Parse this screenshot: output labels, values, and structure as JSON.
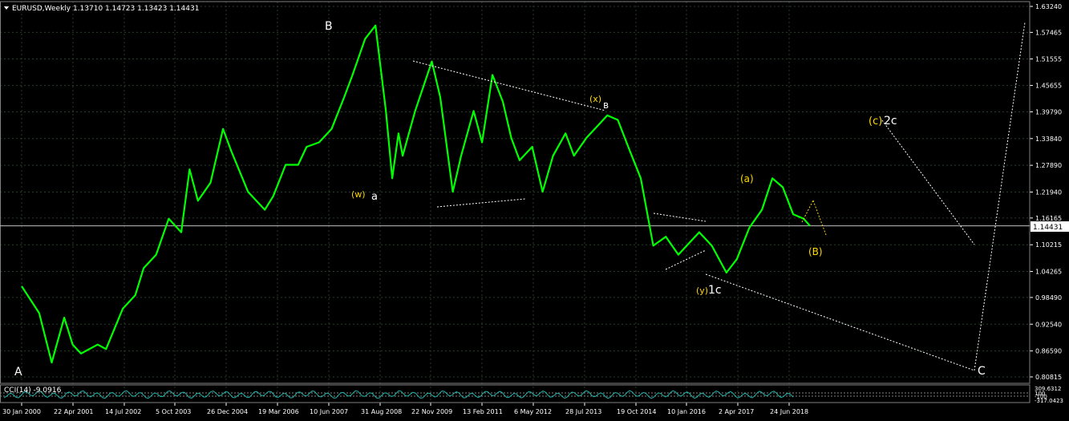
{
  "symbol_header": "EURUSD,Weekly  1.13710 1.14723 1.13423 1.14431",
  "indicator_header": "CCI(14) -9.0916",
  "colors": {
    "background": "#000000",
    "grid": "#2a3d2a",
    "price_line": "#00ff00",
    "axis_text": "#ffffff",
    "wave_white": "#ffffff",
    "wave_yellow": "#ffd700",
    "bid_line": "#c0c0c0"
  },
  "chart_data": {
    "type": "line",
    "title": "EURUSD,Weekly",
    "ohlc_last": {
      "open": 1.1371,
      "high": 1.14723,
      "low": 1.13423,
      "close": 1.14431
    },
    "current_price_label": "1.14431",
    "x_tick_labels": [
      "30 Jan 2000",
      "22 Apr 2001",
      "14 Jul 2002",
      "5 Oct 2003",
      "26 Dec 2004",
      "19 Mar 2006",
      "10 Jun 2007",
      "31 Aug 2008",
      "22 Nov 2009",
      "13 Feb 2011",
      "6 May 2012",
      "28 Jul 2013",
      "19 Oct 2014",
      "10 Jan 2016",
      "2 Apr 2017",
      "24 Jun 2018"
    ],
    "y_tick_labels": [
      "1.63240",
      "1.57465",
      "1.51555",
      "1.45655",
      "1.39790",
      "1.33840",
      "1.27890",
      "1.21940",
      "1.16165",
      "1.10215",
      "1.04265",
      "0.98490",
      "0.92540",
      "0.86590",
      "0.80815"
    ],
    "ylim": [
      0.80815,
      1.6324
    ],
    "grid": true,
    "series": [
      {
        "name": "EURUSD",
        "x": [
          2000.08,
          2000.5,
          2000.8,
          2001.1,
          2001.3,
          2001.5,
          2001.9,
          2002.1,
          2002.5,
          2002.8,
          2003.0,
          2003.3,
          2003.6,
          2003.9,
          2004.1,
          2004.3,
          2004.6,
          2004.9,
          2005.1,
          2005.5,
          2005.9,
          2006.1,
          2006.4,
          2006.7,
          2006.9,
          2007.2,
          2007.5,
          2007.8,
          2008.0,
          2008.3,
          2008.55,
          2008.8,
          2008.95,
          2009.1,
          2009.2,
          2009.5,
          2009.9,
          2010.1,
          2010.4,
          2010.6,
          2010.9,
          2011.1,
          2011.35,
          2011.6,
          2011.8,
          2012.0,
          2012.3,
          2012.55,
          2012.8,
          2013.1,
          2013.3,
          2013.6,
          2013.9,
          2014.1,
          2014.35,
          2014.6,
          2014.9,
          2015.2,
          2015.5,
          2015.8,
          2016.0,
          2016.3,
          2016.6,
          2016.95,
          2017.2,
          2017.5,
          2017.8,
          2018.05,
          2018.3,
          2018.55,
          2018.8,
          2018.95
        ],
        "values": [
          1.01,
          0.95,
          0.84,
          0.94,
          0.88,
          0.86,
          0.88,
          0.87,
          0.96,
          0.99,
          1.05,
          1.08,
          1.16,
          1.13,
          1.27,
          1.2,
          1.24,
          1.36,
          1.31,
          1.22,
          1.18,
          1.21,
          1.28,
          1.28,
          1.32,
          1.33,
          1.36,
          1.43,
          1.48,
          1.56,
          1.59,
          1.4,
          1.25,
          1.35,
          1.3,
          1.4,
          1.51,
          1.43,
          1.22,
          1.3,
          1.4,
          1.33,
          1.48,
          1.42,
          1.34,
          1.29,
          1.32,
          1.22,
          1.3,
          1.35,
          1.3,
          1.34,
          1.37,
          1.39,
          1.38,
          1.32,
          1.25,
          1.1,
          1.12,
          1.08,
          1.1,
          1.13,
          1.1,
          1.04,
          1.07,
          1.14,
          1.18,
          1.25,
          1.23,
          1.17,
          1.16,
          1.14431
        ]
      }
    ],
    "annotations": [
      {
        "text": "A",
        "color": "white"
      },
      {
        "text": "B",
        "color": "white"
      },
      {
        "text": "(w)",
        "color": "yellow"
      },
      {
        "text": "a",
        "color": "white"
      },
      {
        "text": "(x)",
        "color": "yellow"
      },
      {
        "text": "в",
        "color": "white"
      },
      {
        "text": "(y)",
        "color": "yellow"
      },
      {
        "text": "1c",
        "color": "white"
      },
      {
        "text": "(a)",
        "color": "yellow"
      },
      {
        "text": "(B)",
        "color": "yellow"
      },
      {
        "text": "(c)",
        "color": "yellow"
      },
      {
        "text": "2c",
        "color": "white"
      },
      {
        "text": "C",
        "color": "white"
      }
    ],
    "indicator": {
      "name": "CCI(14)",
      "value": -9.0916,
      "y_tick_labels": [
        "309.6312",
        "100",
        "-100",
        "-317.0423"
      ]
    }
  }
}
